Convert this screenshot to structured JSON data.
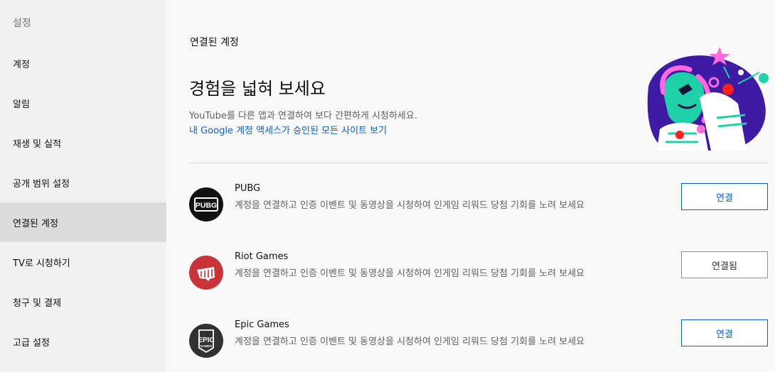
{
  "sidebar": {
    "title": "설정",
    "items": [
      {
        "label": "계정"
      },
      {
        "label": "알림"
      },
      {
        "label": "재생 및 실적"
      },
      {
        "label": "공개 범위 설정"
      },
      {
        "label": "연결된 계정",
        "active": true
      },
      {
        "label": "TV로 시청하기"
      },
      {
        "label": "청구 및 결제"
      },
      {
        "label": "고급 설정"
      }
    ]
  },
  "main": {
    "section_label": "연결된 계정",
    "headline": "경험을 넓혀 보세요",
    "description": "YouTube를 다른 앱과 연결하여 보다 간편하게 시청하세요.",
    "permissions_link": "내 Google 계정 액세스가 승인된 모든 사이트 보기",
    "apps": [
      {
        "name": "PUBG",
        "logo_text": "PUBG",
        "description": "계정을 연결하고 인증 이벤트 및 동영상을 시청하여 인게임 리워드 당첨 기회를 노려 보세요",
        "button": "연결",
        "connected": false
      },
      {
        "name": "Riot Games",
        "logo_text": "",
        "description": "계정을 연결하고 인증 이벤트 및 동영상을 시청하여 인게임 리워드 당첨 기회를 노려 보세요",
        "button": "연결됨",
        "connected": true
      },
      {
        "name": "Epic Games",
        "logo_text": "EPIC",
        "logo_subtext": "GAMES",
        "description": "계정을 연결하고 인증 이벤트 및 동영상을 시청하여 인게임 리워드 당첨 기회를 노려 보세요",
        "button": "연결",
        "connected": false
      }
    ]
  },
  "colors": {
    "link": "#065fd4",
    "sidebar_bg": "#f1f1f1",
    "active_item_bg": "#dcdcdc",
    "riot_red": "#c8343a"
  }
}
